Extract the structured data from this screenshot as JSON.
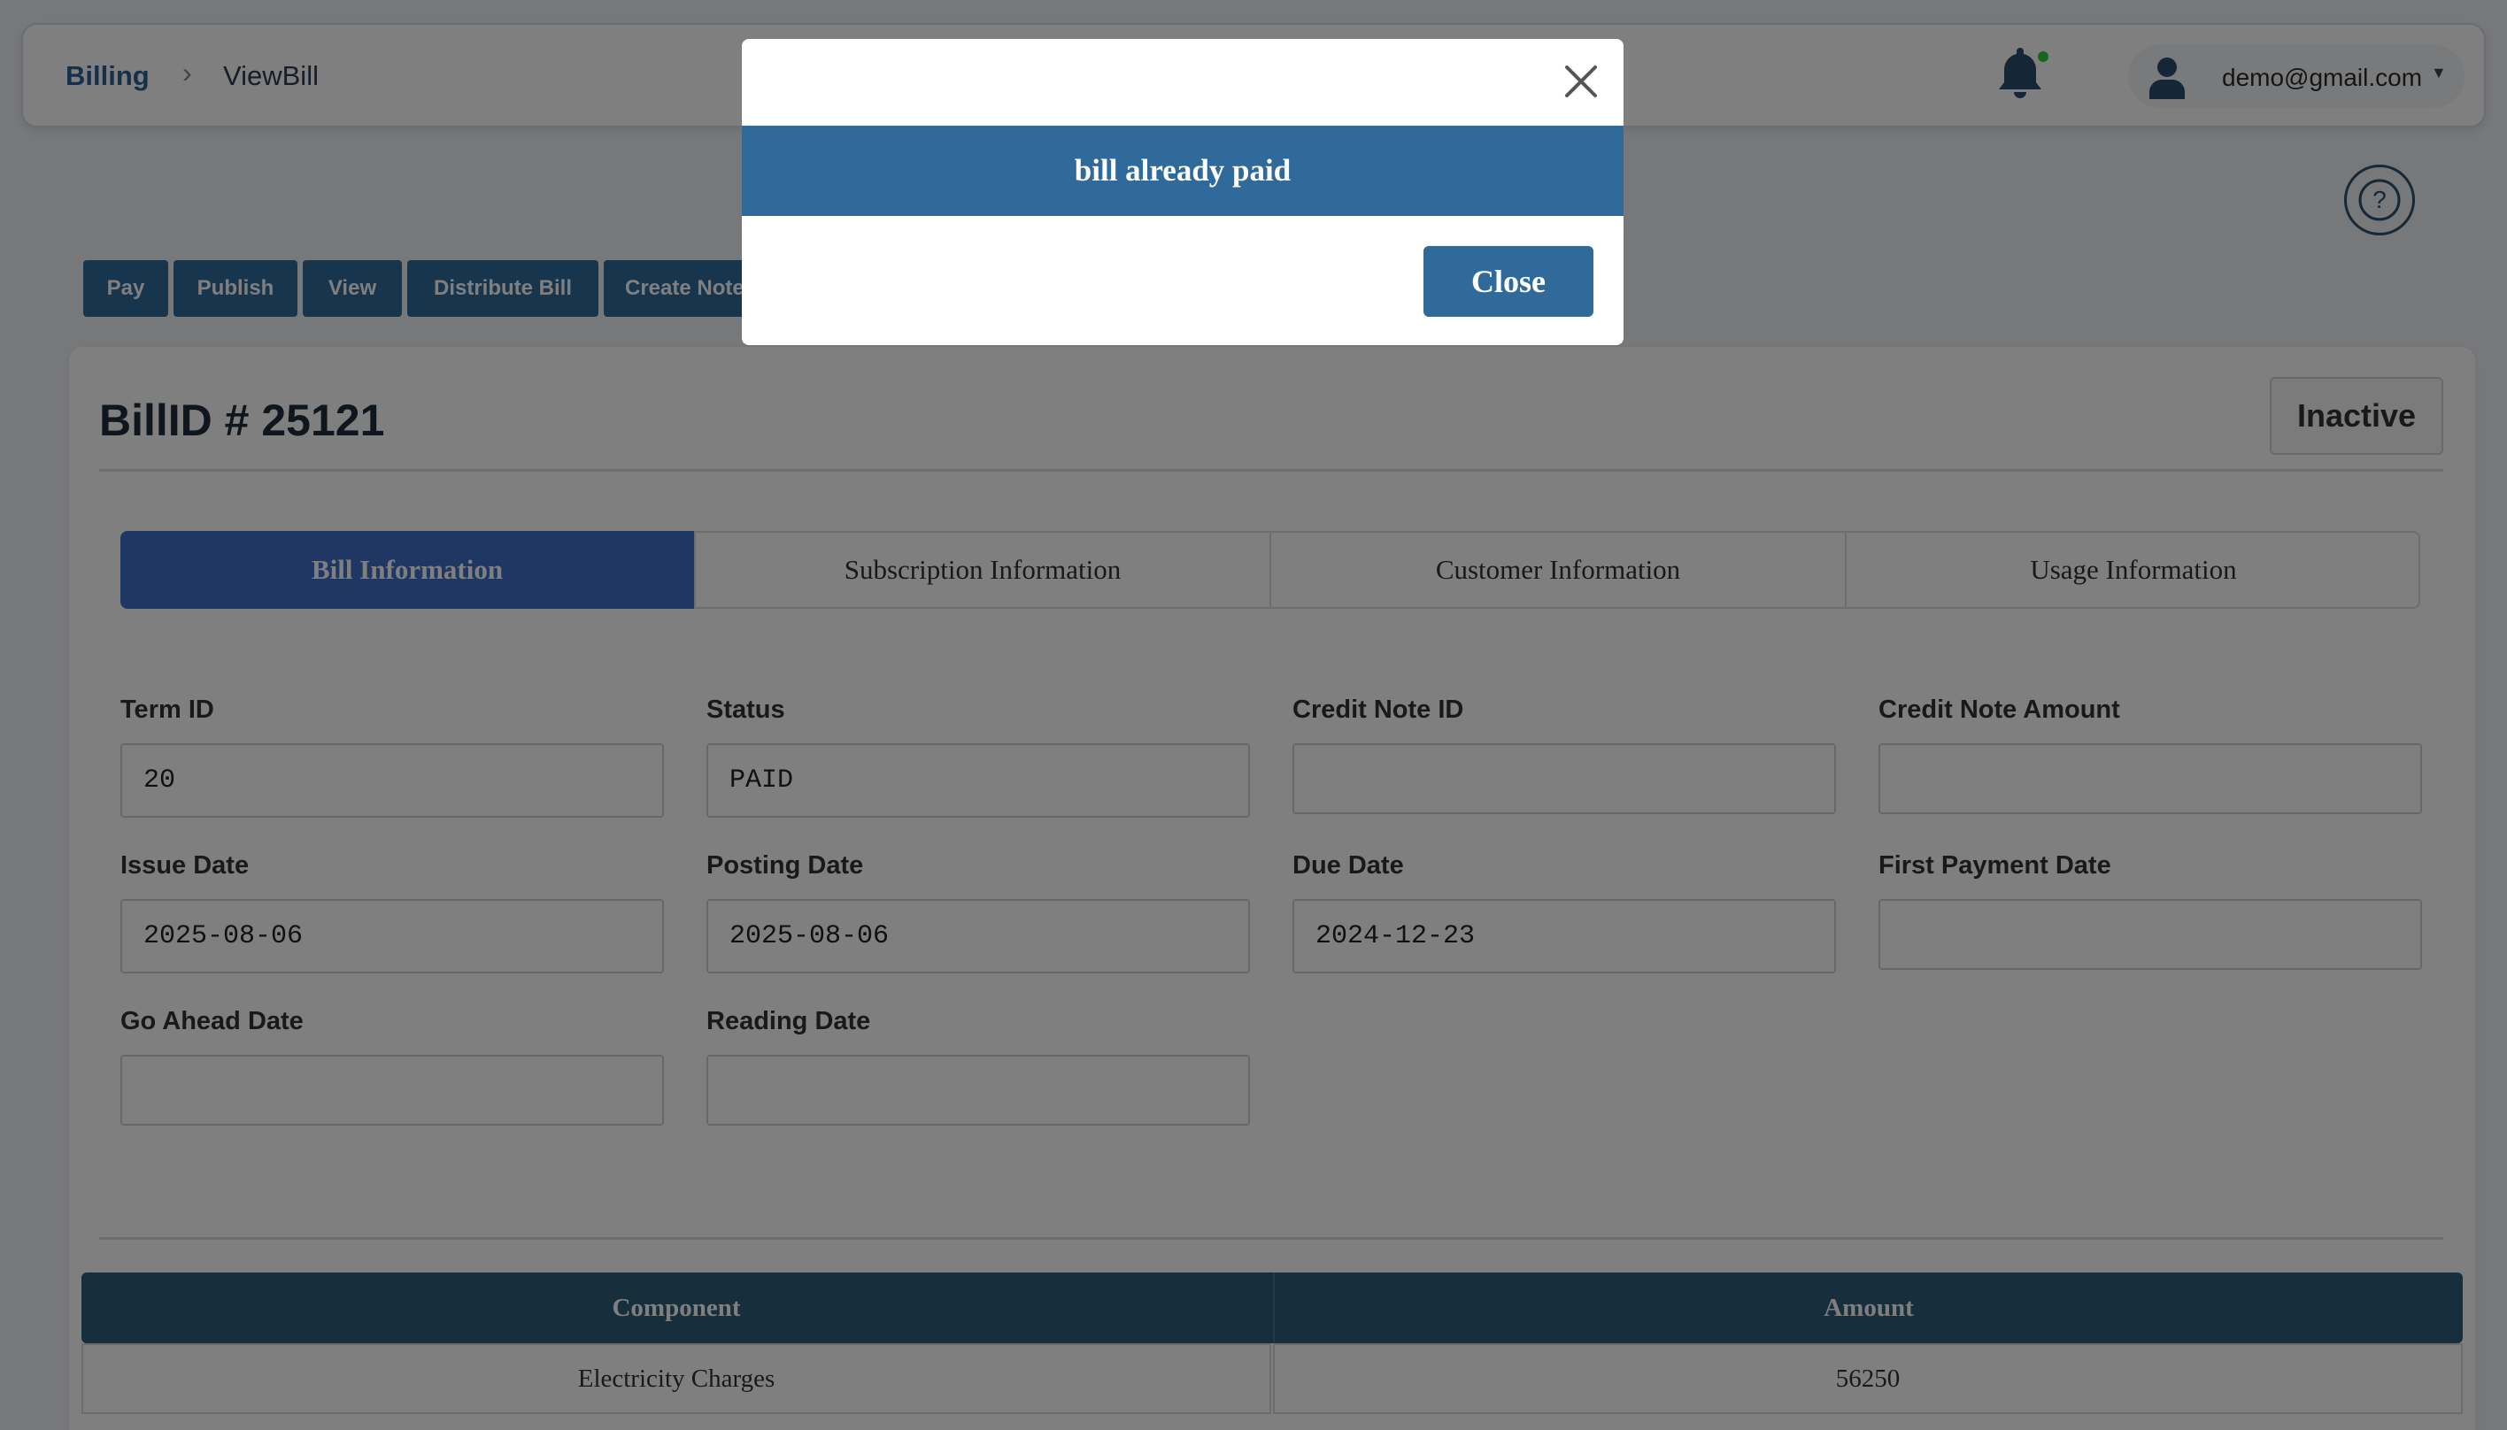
{
  "breadcrumb": {
    "root": "Billing",
    "current": "ViewBill"
  },
  "user": {
    "email": "demo@gmail.com"
  },
  "toolbar": [
    "Pay",
    "Publish",
    "View",
    "Distribute Bill",
    "Create Note"
  ],
  "bill": {
    "title": "BillID # 25121",
    "status": "Inactive"
  },
  "tabs": [
    "Bill Information",
    "Subscription Information",
    "Customer Information",
    "Usage Information"
  ],
  "fields": {
    "term_id": {
      "label": "Term ID",
      "value": "20"
    },
    "status": {
      "label": "Status",
      "value": "PAID"
    },
    "credit_note_id": {
      "label": "Credit Note ID",
      "value": ""
    },
    "credit_note_amount": {
      "label": "Credit Note Amount",
      "value": ""
    },
    "issue_date": {
      "label": "Issue Date",
      "value": "2025-08-06"
    },
    "posting_date": {
      "label": "Posting Date",
      "value": "2025-08-06"
    },
    "due_date": {
      "label": "Due Date",
      "value": "2024-12-23"
    },
    "first_payment_date": {
      "label": "First Payment Date",
      "value": ""
    },
    "go_ahead_date": {
      "label": "Go Ahead Date",
      "value": ""
    },
    "reading_date": {
      "label": "Reading Date",
      "value": ""
    }
  },
  "table": {
    "headers": [
      "Component",
      "Amount"
    ],
    "rows": [
      [
        "Electricity Charges",
        "56250"
      ]
    ]
  },
  "modal": {
    "message": "bill already paid",
    "button": "Close"
  },
  "colors": {
    "primary": "#2f6a9a",
    "tab_active": "#3f6fc4",
    "table_header": "#2f5e7a",
    "notification_dot": "#2ecc40"
  }
}
